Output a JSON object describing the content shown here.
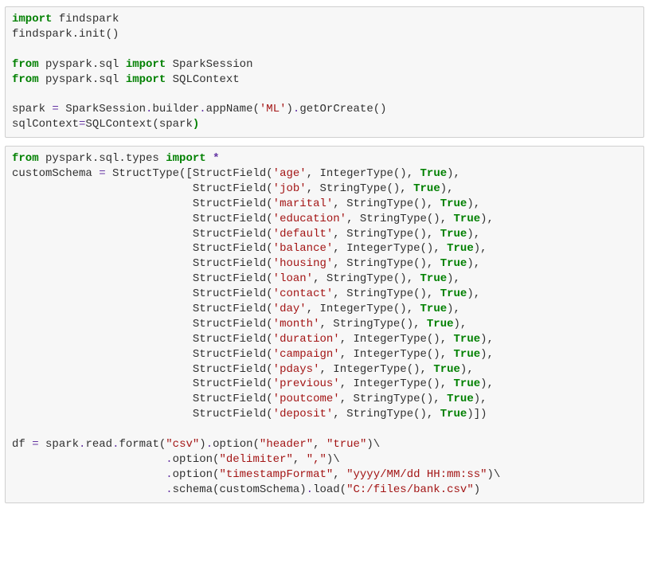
{
  "cell1": {
    "l1a": "import",
    "l1b": " findspark",
    "l2": "findspark.init()",
    "l3": "",
    "l4a": "from",
    "l4b": " pyspark.sql ",
    "l4c": "import",
    "l4d": " SparkSession",
    "l5a": "from",
    "l5b": " pyspark.sql ",
    "l5c": "import",
    "l5d": " SQLContext",
    "l6": "",
    "l7a": "spark ",
    "l7b": "=",
    "l7c": " SparkSession",
    "l7d": ".",
    "l7e": "builder",
    "l7f": ".",
    "l7g": "appName(",
    "l7h": "'ML'",
    "l7i": ")",
    "l7j": ".",
    "l7k": "getOrCreate()",
    "l8a": "sqlContext",
    "l8b": "=",
    "l8c": "SQLContext(spark",
    "l8d": ")"
  },
  "cell2": {
    "h1a": "from",
    "h1b": " pyspark.sql.types ",
    "h1c": "import",
    "h1d": " ",
    "h1e": "*",
    "h2a": "customSchema ",
    "h2b": "=",
    "h2c": " StructType([StructField(",
    "h2d": "'age'",
    "h2e": ", IntegerType(), ",
    "h2f": "True",
    "h2g": "),",
    "indent": "                           ",
    "sf": "StructField(",
    "fields": [
      {
        "name": "'job'",
        "type": ", StringType(), "
      },
      {
        "name": "'marital'",
        "type": ", StringType(), "
      },
      {
        "name": "'education'",
        "type": ", StringType(), "
      },
      {
        "name": "'default'",
        "type": ", StringType(), "
      },
      {
        "name": "'balance'",
        "type": ", IntegerType(), "
      },
      {
        "name": "'housing'",
        "type": ", StringType(), "
      },
      {
        "name": "'loan'",
        "type": ", StringType(), "
      },
      {
        "name": "'contact'",
        "type": ", StringType(), "
      },
      {
        "name": "'day'",
        "type": ", IntegerType(), "
      },
      {
        "name": "'month'",
        "type": ", StringType(), "
      },
      {
        "name": "'duration'",
        "type": ", IntegerType(), "
      },
      {
        "name": "'campaign'",
        "type": ", IntegerType(), "
      },
      {
        "name": "'pdays'",
        "type": ", IntegerType(), "
      },
      {
        "name": "'previous'",
        "type": ", IntegerType(), "
      },
      {
        "name": "'poutcome'",
        "type": ", StringType(), "
      },
      {
        "name": "'deposit'",
        "type": ", StringType(), "
      }
    ],
    "trueTok": "True",
    "closeMid": "),",
    "closeLast": ")])",
    "blank": "",
    "r1a": "df ",
    "r1b": "=",
    "r1c": " spark",
    "r1d": ".",
    "r1e": "read",
    "r1f": ".",
    "r1g": "format(",
    "r1h": "\"csv\"",
    "r1i": ")",
    "r1j": ".",
    "r1k": "option(",
    "r1l": "\"header\"",
    "r1m": ", ",
    "r1n": "\"true\"",
    "r1o": ")\\",
    "rindent": "                       ",
    "r2a": ".",
    "r2b": "option(",
    "r2c": "\"delimiter\"",
    "r2d": ", ",
    "r2e": "\",\"",
    "r2f": ")\\",
    "r3a": ".",
    "r3b": "option(",
    "r3c": "\"timestampFormat\"",
    "r3d": ", ",
    "r3e": "\"yyyy/MM/dd HH:mm:ss\"",
    "r3f": ")\\",
    "r4a": ".",
    "r4b": "schema(customSchema)",
    "r4c": ".",
    "r4d": "load(",
    "r4e": "\"C:/files/bank.csv\"",
    "r4f": ")"
  }
}
